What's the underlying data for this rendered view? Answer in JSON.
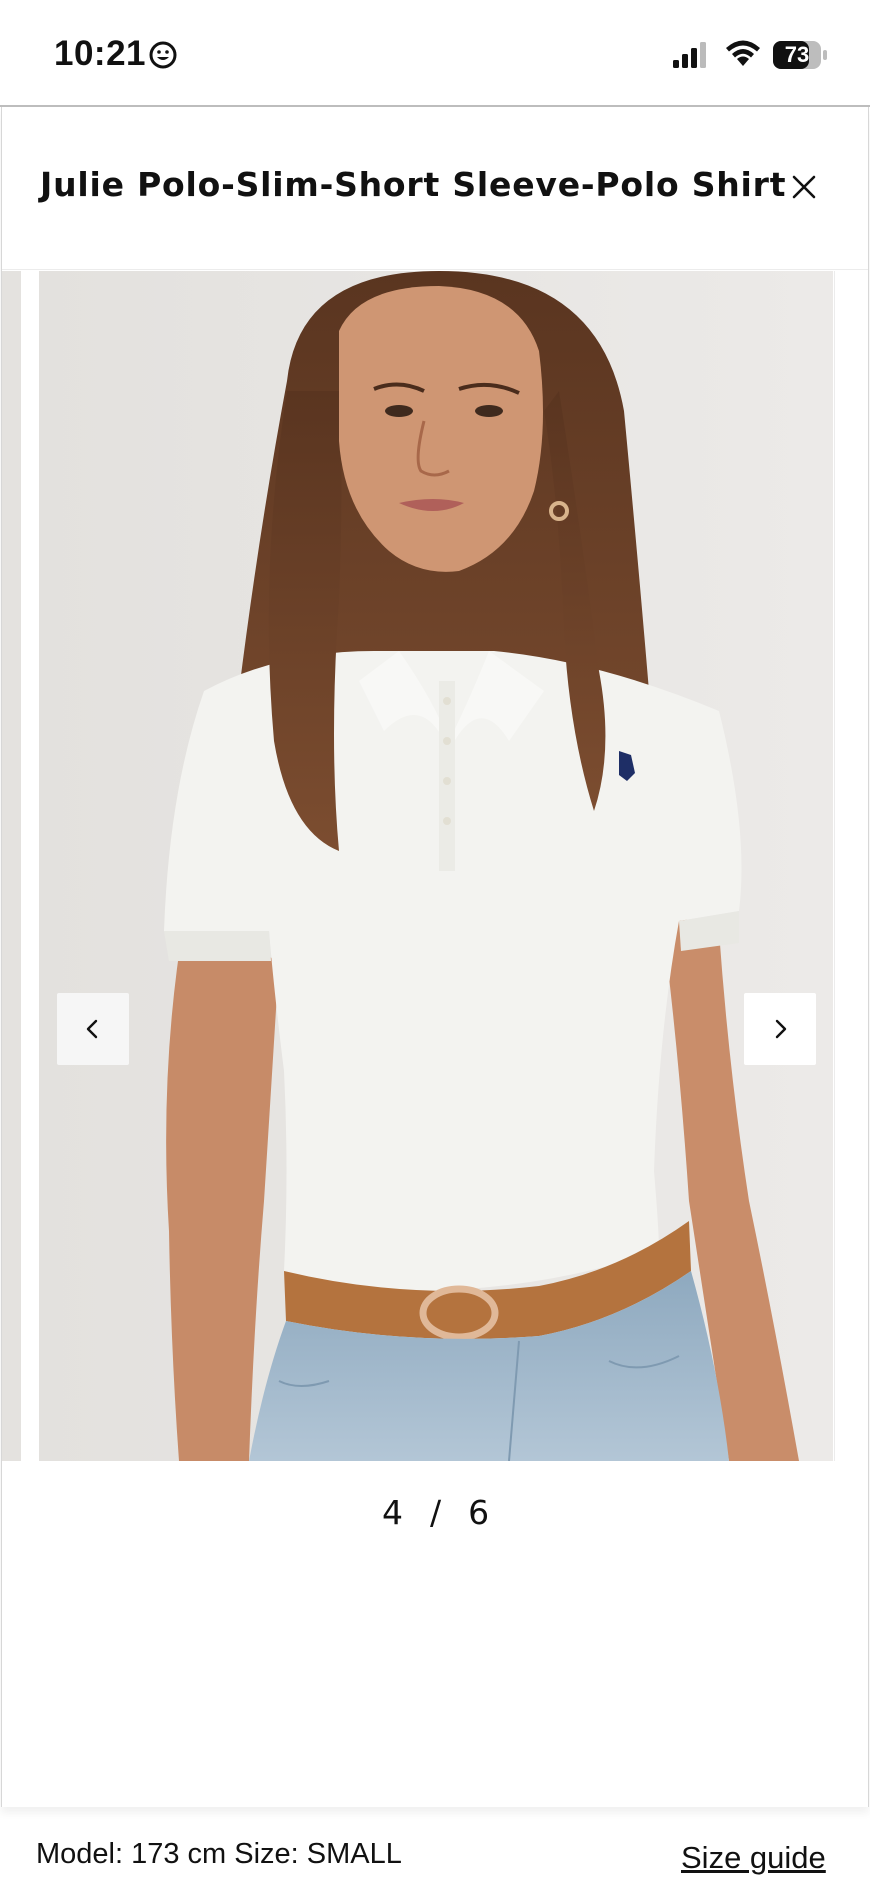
{
  "status_bar": {
    "time": "10:21",
    "battery_level": "73",
    "icons": [
      "smiley-emoji-icon",
      "cellular-signal-icon",
      "wifi-icon",
      "battery-icon"
    ]
  },
  "header": {
    "title": "Julie Polo-Slim-Short Sleeve-Polo Shirt",
    "close_icon": "close-icon"
  },
  "gallery": {
    "current": "4",
    "separator": "/",
    "total": "6",
    "prev_icon": "chevron-left-icon",
    "next_icon": "chevron-right-icon"
  },
  "footer": {
    "model_info": "Model: 173 cm Size: SMALL",
    "size_guide": "Size guide"
  },
  "colors": {
    "text": "#111111",
    "divider": "#bdbdbd",
    "nav_button_bg": "#f6f6f6",
    "photo_background": "#e6e4e1",
    "shirt": "#f4f4f1",
    "denim": "#9fb7cb",
    "belt": "#b4733e",
    "hair": "#6b4128"
  }
}
